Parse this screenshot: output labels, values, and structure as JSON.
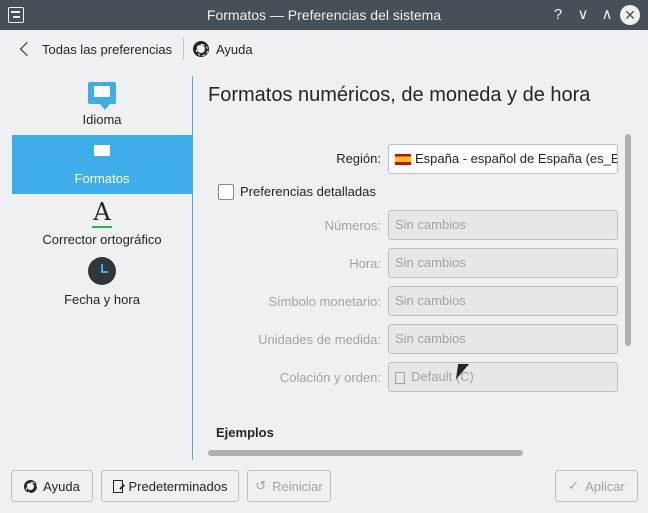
{
  "window": {
    "title": "Formatos — Preferencias del sistema",
    "help_glyph": "?",
    "min_glyph": "∨",
    "max_glyph": "∧",
    "close_glyph": "✕"
  },
  "nav": {
    "back_label": "Todas las preferencias",
    "help_label": "Ayuda"
  },
  "sidebar": {
    "items": [
      {
        "label": "Idioma",
        "icon": "speech-bubble-icon"
      },
      {
        "label": "Formatos",
        "icon": "speech-bubble-icon",
        "active": true
      },
      {
        "label": "Corrector ortográfico",
        "icon": "spellcheck-icon"
      },
      {
        "label": "Fecha y hora",
        "icon": "clock-icon"
      }
    ]
  },
  "main": {
    "title": "Formatos numéricos, de moneda y de hora",
    "region_label": "Región:",
    "region_value": "España - español de España (es_ES)",
    "detailed_label": "Preferencias detalladas",
    "detailed_checked": false,
    "rows": [
      {
        "label": "Números:",
        "value": "Sin cambios"
      },
      {
        "label": "Hora:",
        "value": "Sin cambios"
      },
      {
        "label": "Símbolo monetario:",
        "value": "Sin cambios"
      },
      {
        "label": "Unidades de medida:",
        "value": "Sin cambios"
      },
      {
        "label": "Colación y orden:",
        "value": "Default (C)"
      }
    ],
    "examples_label": "Ejemplos"
  },
  "footer": {
    "help_label": "Ayuda",
    "defaults_label": "Predeterminados",
    "reset_label": "Reiniciar",
    "reset_glyph": "↺",
    "apply_label": "Aplicar",
    "apply_glyph": "✓"
  },
  "colors": {
    "accent": "#3daee9",
    "titlebar": "#475057",
    "window_bg": "#eff0f1"
  }
}
